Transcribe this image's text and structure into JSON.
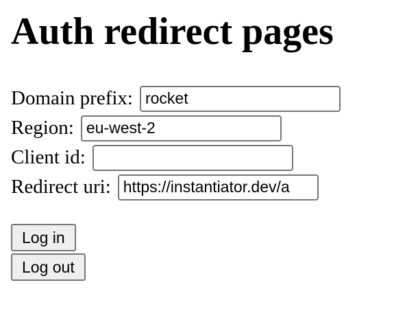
{
  "page": {
    "title": "Auth redirect pages"
  },
  "form": {
    "domain_prefix": {
      "label": "Domain prefix:",
      "value": "rocket"
    },
    "region": {
      "label": "Region:",
      "value": "eu-west-2"
    },
    "client_id": {
      "label": "Client id:",
      "value": ""
    },
    "redirect_uri": {
      "label": "Redirect uri:",
      "value": "https://instantiator.dev/a"
    }
  },
  "actions": {
    "login_label": "Log in",
    "logout_label": "Log out"
  }
}
